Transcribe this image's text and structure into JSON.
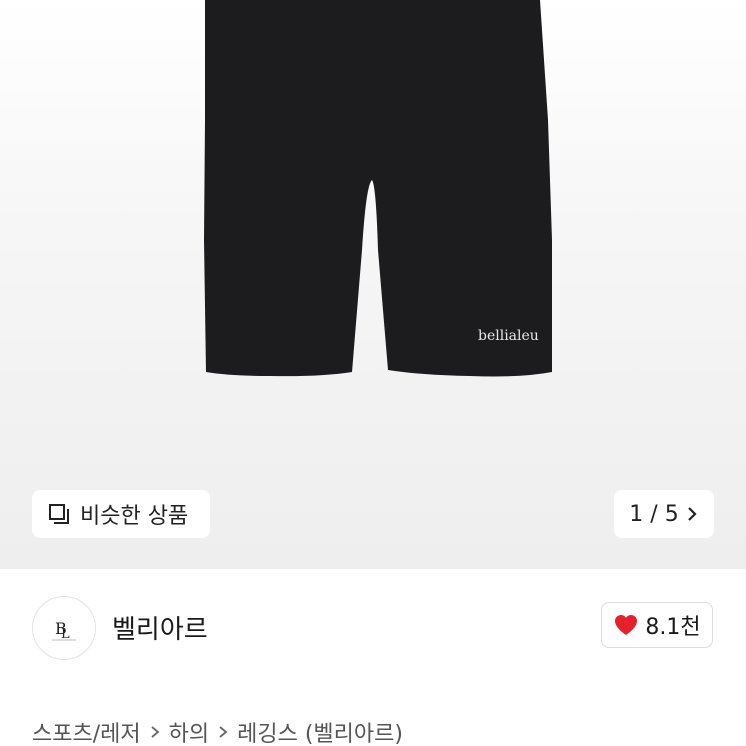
{
  "product": {
    "image_alt": "black biker shorts",
    "brand_print": "bellialeu"
  },
  "overlay": {
    "similar_label": "비슷한 상품",
    "pager_current": "1",
    "pager_total": "5",
    "pager_text": "1 / 5"
  },
  "shop": {
    "name": "벨리아르",
    "likes": "8.1천",
    "logo_letters": "BL"
  },
  "breadcrumb": {
    "items": [
      "스포츠/레저",
      "하의",
      "레깅스 (벨리아르)"
    ]
  },
  "colors": {
    "heart": "#e5202b",
    "shorts": "#1c1c1e"
  },
  "icons": {
    "similar": "stack-squares-icon",
    "pager": "chevron-right-icon",
    "like": "heart-icon",
    "separator": "chevron-right-icon"
  }
}
